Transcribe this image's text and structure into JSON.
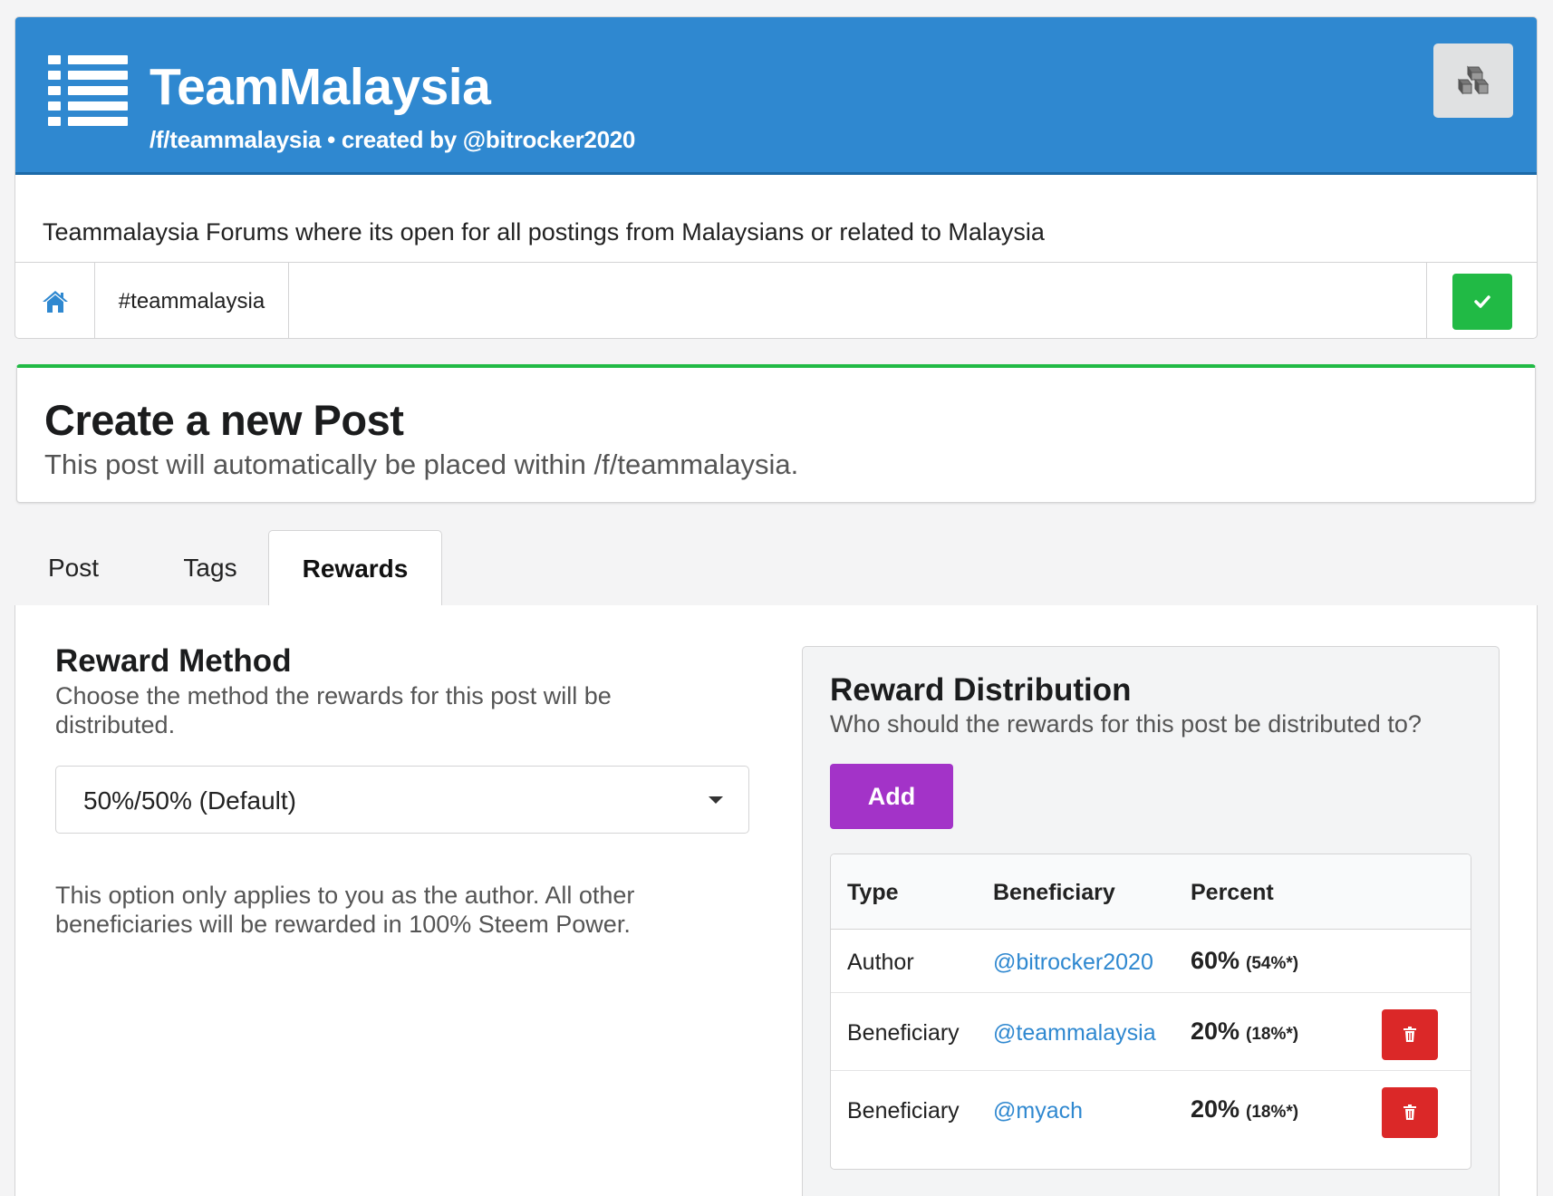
{
  "forum": {
    "title": "TeamMalaysia",
    "subtitle": "/f/teammalaysia • created by @bitrocker2020",
    "description": "Teammalaysia Forums where its open for all postings from Malaysians or related to Malaysia",
    "tag": "#teammalaysia",
    "icons": {
      "header": "list-icon",
      "action": "cubes-icon",
      "home": "home-icon",
      "confirm": "check-icon"
    },
    "colors": {
      "header": "#2f88d0",
      "confirm": "#21ba45"
    }
  },
  "create": {
    "title": "Create a new Post",
    "subtitle": "This post will automatically be placed within /f/teammalaysia."
  },
  "tabs": [
    {
      "label": "Post",
      "active": false
    },
    {
      "label": "Tags",
      "active": false
    },
    {
      "label": "Rewards",
      "active": true
    }
  ],
  "reward_method": {
    "title": "Reward Method",
    "subtitle": "Choose the method the rewards for this post will be distributed.",
    "selected": "50%/50% (Default)",
    "note": "This option only applies to you as the author. All other beneficiaries will be rewarded in 100% Steem Power."
  },
  "reward_distribution": {
    "title": "Reward Distribution",
    "subtitle": "Who should the rewards for this post be distributed to?",
    "add_label": "Add",
    "add_color": "#a333c8",
    "delete_color": "#db2828",
    "columns": [
      "Type",
      "Beneficiary",
      "Percent"
    ],
    "rows": [
      {
        "type": "Author",
        "beneficiary": "@bitrocker2020",
        "percent": "60%",
        "percent_note": "(54%*)",
        "deletable": false
      },
      {
        "type": "Beneficiary",
        "beneficiary": "@teammalaysia",
        "percent": "20%",
        "percent_note": "(18%*)",
        "deletable": true
      },
      {
        "type": "Beneficiary",
        "beneficiary": "@myach",
        "percent": "20%",
        "percent_note": "(18%*)",
        "deletable": true
      }
    ]
  }
}
